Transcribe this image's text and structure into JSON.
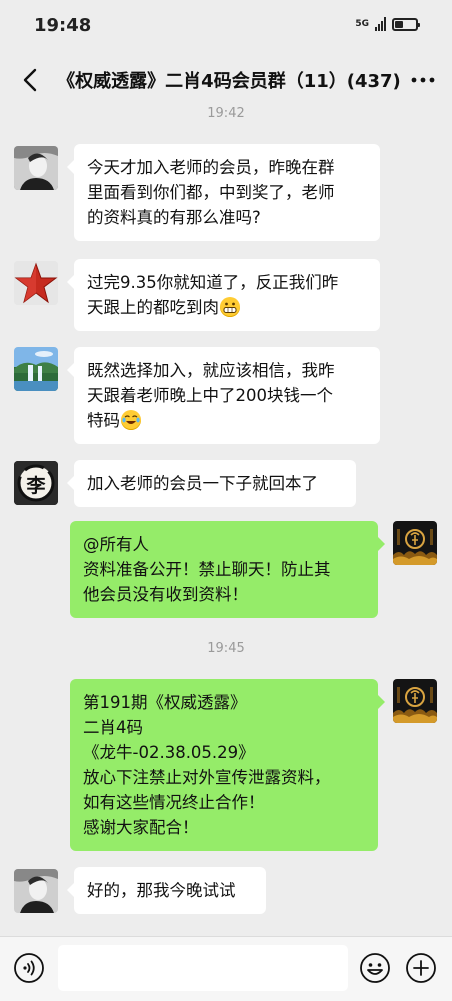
{
  "status_bar": {
    "time": "19:48",
    "network": "5G"
  },
  "nav": {
    "title": "《权威透露》二肖4码会员群（11）(437)"
  },
  "top_time": "19:42",
  "mid_time": "19:45",
  "messages": [
    {
      "side": "left",
      "avatar": "avatar-man-photo",
      "text": "今天才加入老师的会员，昨晚在群\n里面看到你们都，中到奖了，老师\n的资料真的有那么准吗?"
    },
    {
      "side": "left",
      "avatar": "avatar-red-star",
      "text": "过完9.35你就知道了，反正我们昨\n天跟上的都吃到肉",
      "emoji": "grinning-emoji"
    },
    {
      "side": "left",
      "avatar": "avatar-waterfall",
      "text": "既然选择加入，就应该相信，我昨\n天跟着老师晚上中了200块钱一个\n特码",
      "emoji": "laughing-tears-emoji"
    },
    {
      "side": "left",
      "avatar": "avatar-li-calligraphy",
      "avatar_char": "李",
      "text": "加入老师的会员一下子就回本了"
    },
    {
      "side": "right",
      "avatar": "avatar-group-owner",
      "text": "@所有人\n资料准备公开！禁止聊天！防止其\n他会员没有收到资料！"
    },
    {
      "side": "right",
      "avatar": "avatar-group-owner",
      "text": "第191期《权威透露》\n二肖4码\n《龙牛-02.38.05.29》\n放心下注禁止对外宣传泄露资料，\n如有这些情况终止合作！\n感谢大家配合！"
    },
    {
      "side": "left",
      "avatar": "avatar-man-photo",
      "text": "好的，那我今晚试试"
    }
  ],
  "input": {
    "placeholder": ""
  },
  "colors": {
    "background": "#ededed",
    "bubble_self": "#95ec69",
    "bubble_other": "#ffffff"
  }
}
